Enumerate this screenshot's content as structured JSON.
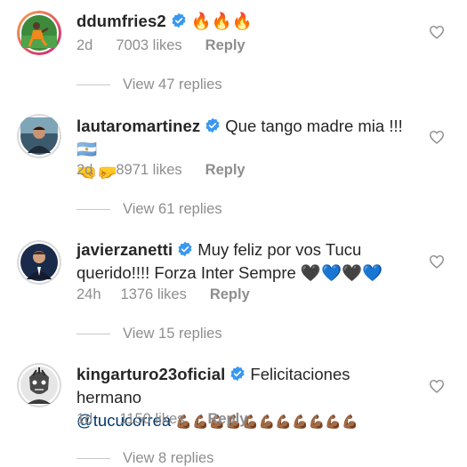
{
  "comments": [
    {
      "username": "ddumfries2",
      "text": "🔥🔥🔥",
      "text2": "",
      "time": "2d",
      "likes": "7003 likes",
      "reply": "Reply",
      "view_replies": "View 47 replies"
    },
    {
      "username": "lautaromartinez",
      "text": "Que tango madre mia !!! 🇦🇷",
      "text2": "🤜🤛",
      "time": "2d",
      "likes": "8971 likes",
      "reply": "Reply",
      "view_replies": "View 61 replies"
    },
    {
      "username": "javierzanetti",
      "text": "Muy feliz por vos Tucu",
      "text2": "querido!!!! Forza Inter Sempre 🖤💙🖤💙",
      "time": "24h",
      "likes": "1376 likes",
      "reply": "Reply",
      "view_replies": "View 15 replies"
    },
    {
      "username": "kingarturo23oficial",
      "text": "Felicitaciones hermano",
      "mention": "@tucucorrea",
      "text2": "💪🏾💪🏾💪🏾💪🏾💪🏾💪🏾💪🏾💪🏾💪🏾💪🏾💪🏾",
      "time": "1d",
      "likes": "1150 likes",
      "reply": "Reply",
      "view_replies": "View 8 replies"
    }
  ],
  "icons": {
    "verified": "verified-badge-icon",
    "like": "heart-outline-icon"
  },
  "colors": {
    "verified_blue": "#3897f0",
    "secondary_text": "#8e8e8e",
    "primary_text": "#262626",
    "mention": "#00376b"
  }
}
